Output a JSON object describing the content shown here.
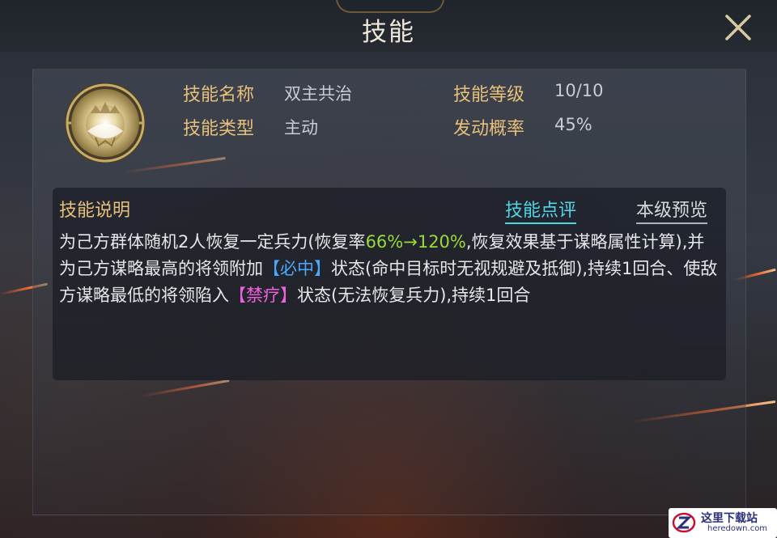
{
  "header": {
    "title": "技能"
  },
  "skill": {
    "name_label": "技能名称",
    "name_value": "双主共治",
    "type_label": "技能类型",
    "type_value": "主动",
    "level_label": "技能等级",
    "level_value": "10/10",
    "chance_label": "发动概率",
    "chance_value": "45%"
  },
  "description": {
    "title": "技能说明",
    "review_link": "技能点评",
    "preview_link": "本级预览",
    "segments": [
      {
        "text": "为己方群体随机2人恢复一定兵力(恢复率",
        "style": "normal"
      },
      {
        "text": "66%→120%",
        "style": "green"
      },
      {
        "text": ",恢复效果基于谋略属性计算),并为己方谋略最高的将领附加",
        "style": "normal"
      },
      {
        "text": "【必中】",
        "style": "blue"
      },
      {
        "text": "状态(命中目标时无视规避及抵御),持续1回合、使敌方谋略最低的将领陷入",
        "style": "normal"
      },
      {
        "text": "【禁疗】",
        "style": "pink"
      },
      {
        "text": "状态(无法恢复兵力),持续1回合",
        "style": "normal"
      }
    ]
  },
  "icons": {
    "close": "close-icon",
    "skill": "skill-emblem-icon"
  },
  "watermark": {
    "name": "这里下载站",
    "url": "heredown.com"
  },
  "colors": {
    "label_gold": "#e7c07a",
    "link_cyan": "#4fd6e8",
    "highlight_green": "#9ad93a",
    "highlight_blue": "#4aa8ff",
    "highlight_pink": "#f060e0"
  }
}
